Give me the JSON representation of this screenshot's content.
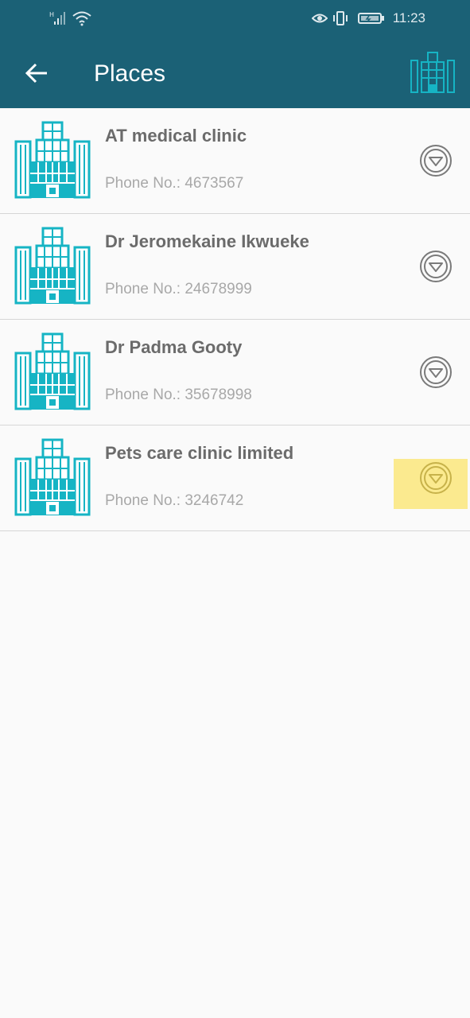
{
  "status_bar": {
    "time": "11:23",
    "icons": [
      "signal-icon",
      "wifi-icon",
      "eye-icon",
      "vibrate-icon",
      "battery-icon"
    ]
  },
  "toolbar": {
    "title": "Places",
    "back_icon": "arrow-left-icon",
    "right_icon": "building-icon"
  },
  "places": [
    {
      "name": "AT medical clinic",
      "phone": "Phone No.: 4673567"
    },
    {
      "name": "Dr Jeromekaine Ikwueke",
      "phone": "Phone No.: 24678999"
    },
    {
      "name": "Dr Padma Gooty",
      "phone": "Phone No.: 35678998"
    },
    {
      "name": "Pets care clinic limited",
      "phone": "Phone No.: 3246742"
    }
  ],
  "colors": {
    "header": "#1b6176",
    "accent": "#16b4c4",
    "highlight": "#fbea8f"
  }
}
